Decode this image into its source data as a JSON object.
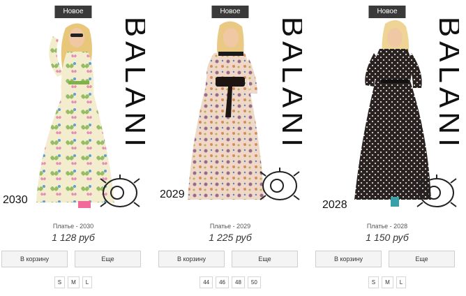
{
  "products": [
    {
      "badge": "Новое",
      "sku": "2030",
      "name": "Платье - 2030",
      "price": "1 128 руб",
      "cart_label": "В корзину",
      "more_label": "Еще",
      "sizes": [
        "S",
        "M",
        "L"
      ],
      "brand_logo": "BALANI",
      "dress_pattern": "butterfly-print",
      "colors": {
        "dress": "#f3eccd",
        "accent": "#7fb24a"
      }
    },
    {
      "badge": "Новое",
      "sku": "2029",
      "name": "Платье - 2029",
      "price": "1 225 руб",
      "cart_label": "В корзину",
      "more_label": "Еще",
      "sizes": [
        "44",
        "46",
        "48",
        "50"
      ],
      "brand_logo": "BALANI",
      "dress_pattern": "floral-print",
      "colors": {
        "dress": "#eed8c8",
        "accent": "#9a6a8a"
      }
    },
    {
      "badge": "Новое",
      "sku": "2028",
      "name": "Платье - 2028",
      "price": "1 150 руб",
      "cart_label": "В корзину",
      "more_label": "Еще",
      "sizes": [
        "S",
        "M",
        "L"
      ],
      "brand_logo": "BALANI",
      "dress_pattern": "polka-dot",
      "colors": {
        "dress": "#2a2220",
        "accent": "#ffffff"
      }
    }
  ]
}
